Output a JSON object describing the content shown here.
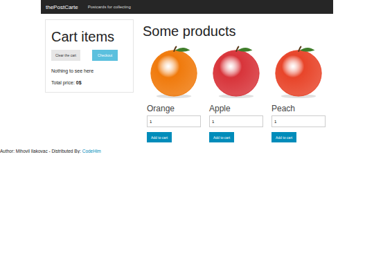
{
  "navbar": {
    "brand": "thePostCarte",
    "links": [
      "Postcards for collecting"
    ]
  },
  "cart": {
    "title": "Cart items",
    "buttons": [
      {
        "label": "Clear the cart",
        "kind": "secondary"
      },
      {
        "label": "Checkout",
        "kind": "info"
      }
    ],
    "empty_message": "Nothing to see here",
    "total": {
      "label": "Total price:",
      "value": "0$"
    }
  },
  "products_section": {
    "title": "Some products",
    "products": [
      {
        "name": "Orange",
        "quantity": "1",
        "button": "Add to cart",
        "color": "#f07a0c"
      },
      {
        "name": "Apple",
        "quantity": "1",
        "button": "Add to cart",
        "color": "#d8343a"
      },
      {
        "name": "Peach",
        "quantity": "1",
        "button": "Add to cart",
        "color": "#e8452a"
      }
    ]
  },
  "footer": {
    "text": "Author: Mihovil Ilakovac - Distributed By:",
    "link": "CodeHim"
  }
}
